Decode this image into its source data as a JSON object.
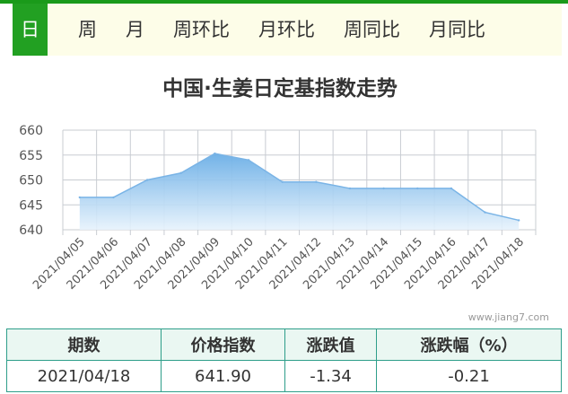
{
  "tabs": [
    "日",
    "周",
    "月",
    "周环比",
    "月环比",
    "周同比",
    "月同比"
  ],
  "active_tab": 0,
  "colors": {
    "accent": "#22a022",
    "tab_bg": "#fdfde8",
    "line": "#7ab4e6",
    "table_border": "#2e9e8a",
    "table_header_bg": "#eaf7f2"
  },
  "chart_data": {
    "type": "area",
    "title": "中国·生姜日定基指数走势",
    "categories": [
      "2021/04/05",
      "2021/04/06",
      "2021/04/07",
      "2021/04/08",
      "2021/04/09",
      "2021/04/10",
      "2021/04/11",
      "2021/04/12",
      "2021/04/13",
      "2021/04/14",
      "2021/04/15",
      "2021/04/16",
      "2021/04/17",
      "2021/04/18"
    ],
    "values": [
      646.5,
      646.5,
      650.0,
      651.4,
      655.3,
      654.0,
      649.6,
      649.6,
      648.3,
      648.3,
      648.3,
      648.3,
      643.5,
      641.9
    ],
    "ylim": [
      640,
      660
    ],
    "yticks": [
      "640",
      "645",
      "650",
      "655",
      "660"
    ],
    "xlabel": "",
    "ylabel": "",
    "grid": true,
    "watermark": "www.jiang7.com"
  },
  "table": {
    "headers": [
      "期数",
      "价格指数",
      "涨跌值",
      "涨跌幅（%）"
    ],
    "row": [
      "2021/04/18",
      "641.90",
      "-1.34",
      "-0.21"
    ]
  }
}
